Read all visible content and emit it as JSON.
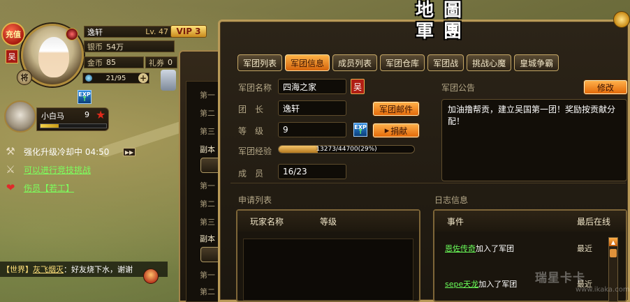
{
  "player": {
    "recharge_label": "充值",
    "faction": "吴",
    "rank_badge": "将",
    "name": "逸轩",
    "level": "Lv. 47",
    "vip": "VIP 3",
    "silver_label": "银币",
    "silver": "54万",
    "gold_label": "金币",
    "gold": "85",
    "coupon_label": "礼券",
    "coupon": "0",
    "energy": "21/95",
    "energy_plus": "+",
    "exp_icon": "EXP"
  },
  "mount": {
    "name": "小白马",
    "level": "9",
    "star_icon": "★",
    "progress": 0.28
  },
  "notices": [
    {
      "icon": "hammer-icon",
      "text": "强化升级冷却中 04:50"
    },
    {
      "icon": "crossed-swords-icon",
      "text": "可以进行竞技挑战"
    },
    {
      "icon": "hearts-icon",
      "text": "伤员【若工】"
    }
  ],
  "speed_label": "▶▶",
  "chat": {
    "channel": "【世界】",
    "user": "灰飞烟灭",
    "message": "：好友烧下水，谢谢"
  },
  "middle_panel": {
    "rows_top": [
      "第一",
      "第二",
      "第三"
    ],
    "section_a": "副本",
    "rows_mid": [
      "第一",
      "第二",
      "第三"
    ],
    "section_b": "副本",
    "rows_bottom": [
      "第一",
      "第二"
    ]
  },
  "window": {
    "title_chars": [
      "地",
      "圖",
      "軍",
      "團"
    ],
    "tabs": [
      "军团列表",
      "军团信息",
      "成员列表",
      "军团仓库",
      "军团战",
      "挑战心魔",
      "皇城争霸"
    ],
    "active_tab": 1
  },
  "legion": {
    "name_label": "军团名称",
    "name": "四海之家",
    "faction": "吴",
    "leader_label": "团　长",
    "leader": "逸轩",
    "mail_button": "军团邮件",
    "level_label": "等　级",
    "level": "9",
    "exp_icon": "EXP",
    "donate_button": "捐献",
    "exp_label": "军团经验",
    "exp_text": "13273/44700(29%)",
    "exp_fraction": 0.29,
    "members_label": "成　员",
    "members": "16/23",
    "announcement_label": "军团公告",
    "edit_button": "修改",
    "announcement": "加油撸帮贡，建立吴国第一团！奖励按贡献分配！"
  },
  "applications": {
    "title": "申请列表",
    "columns": [
      "玩家名称",
      "等级"
    ]
  },
  "log": {
    "title": "日志信息",
    "columns": [
      "事件",
      "最后在线"
    ],
    "entries": [
      {
        "name": "恩佐传奇",
        "action": "加入了军团",
        "time": "最近"
      },
      {
        "name": "sepe天龙",
        "action": "加入了军团",
        "time": "最近"
      }
    ]
  },
  "watermark": {
    "logo": "瑞星卡卡",
    "url": "www.ikaka.com"
  },
  "colors": {
    "accent_orange": "#e36a0a",
    "frame_gold": "#b99a58",
    "link_green": "#6bff5a",
    "badge_red": "#b01e14"
  }
}
